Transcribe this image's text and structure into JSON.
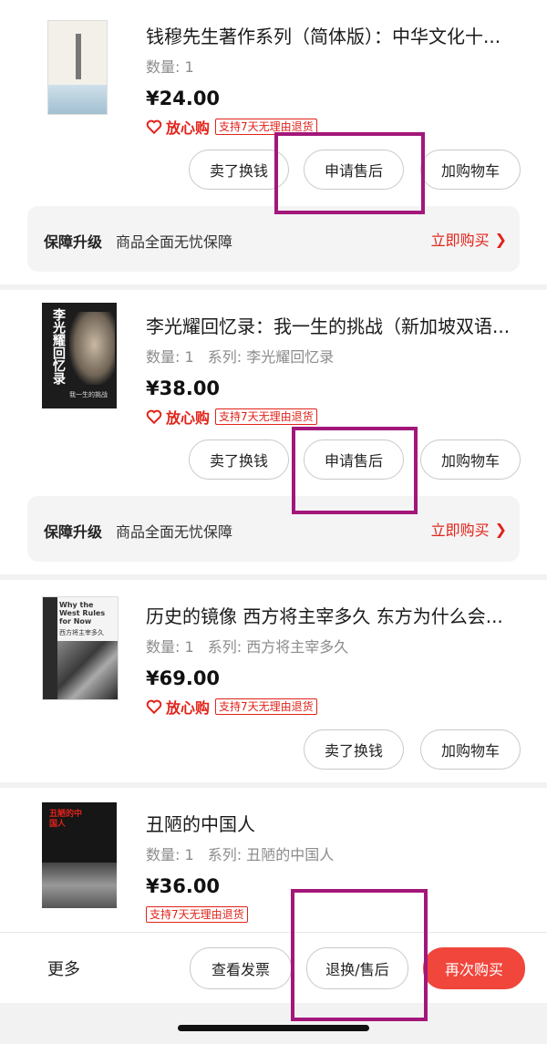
{
  "orders": [
    {
      "title": "钱穆先生著作系列（简体版）：中华文化十...",
      "qty": "数量: 1",
      "series": "",
      "price": "¥24.00",
      "assure": "放心购",
      "return_tag": "支持7天无理由退货",
      "buttons": [
        "卖了换钱",
        "申请售后",
        "加购物车"
      ]
    },
    {
      "title": "李光耀回忆录：我一生的挑战（新加坡双语...",
      "qty": "数量: 1",
      "series": "系列: 李光耀回忆录",
      "price": "¥38.00",
      "assure": "放心购",
      "return_tag": "支持7天无理由退货",
      "buttons": [
        "卖了换钱",
        "申请售后",
        "加购物车"
      ]
    },
    {
      "title": "历史的镜像 西方将主宰多久 东方为什么会...",
      "qty": "数量: 1",
      "series": "系列: 西方将主宰多久",
      "price": "¥69.00",
      "assure": "放心购",
      "return_tag": "支持7天无理由退货",
      "buttons": [
        "卖了换钱",
        "加购物车"
      ]
    },
    {
      "title": "丑陋的中国人",
      "qty": "数量: 1",
      "series": "系列: 丑陋的中国人",
      "price": "¥36.00",
      "return_tag": "支持7天无理由退货"
    }
  ],
  "protection": {
    "title": "保障升级",
    "desc": "商品全面无忧保障",
    "link": "立即购买",
    "chevron": "❯"
  },
  "book_covers": {
    "book2_title": "李光耀回忆录",
    "book2_sub": "我一生的挑战",
    "book3_en": "Why the West Rules for Now",
    "book3_cn": "西方将主宰多久",
    "book4_title": "丑陋的中国人"
  },
  "bottom_bar": {
    "more": "更多",
    "invoice": "查看发票",
    "return_after_sale": "退换/售后",
    "buy_again": "再次购买"
  },
  "colors": {
    "accent_red": "#e2231a",
    "highlight_box": "#a3177a",
    "buy_again_btn": "#f0463c"
  }
}
